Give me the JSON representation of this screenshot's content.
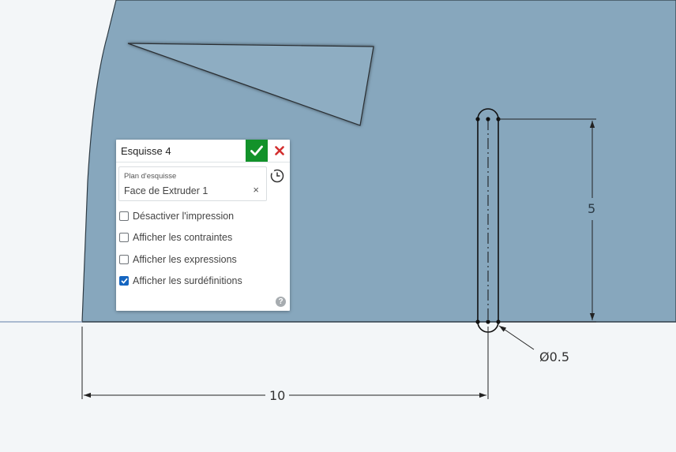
{
  "panel": {
    "title": "Esquisse 4",
    "plane_label": "Plan d'esquisse",
    "plane_value": "Face de Extruder 1",
    "clear_glyph": "×",
    "help_glyph": "?",
    "options": [
      {
        "label": "Désactiver l'impression",
        "checked": false
      },
      {
        "label": "Afficher les contraintes",
        "checked": false
      },
      {
        "label": "Afficher les expressions",
        "checked": false
      },
      {
        "label": "Afficher les surdéfinitions",
        "checked": true
      }
    ]
  },
  "dimensions": {
    "height": "5",
    "width": "10",
    "diameter": "Ø0.5"
  },
  "colors": {
    "face": "#87a7bd",
    "background": "#f3f6f8",
    "confirm": "#12922a",
    "cancel": "#d32f2f",
    "checkbox_checked": "#1565c0"
  },
  "icons": {
    "confirm": "checkmark-icon",
    "cancel": "close-icon",
    "history": "clock-icon",
    "help": "help-icon"
  }
}
